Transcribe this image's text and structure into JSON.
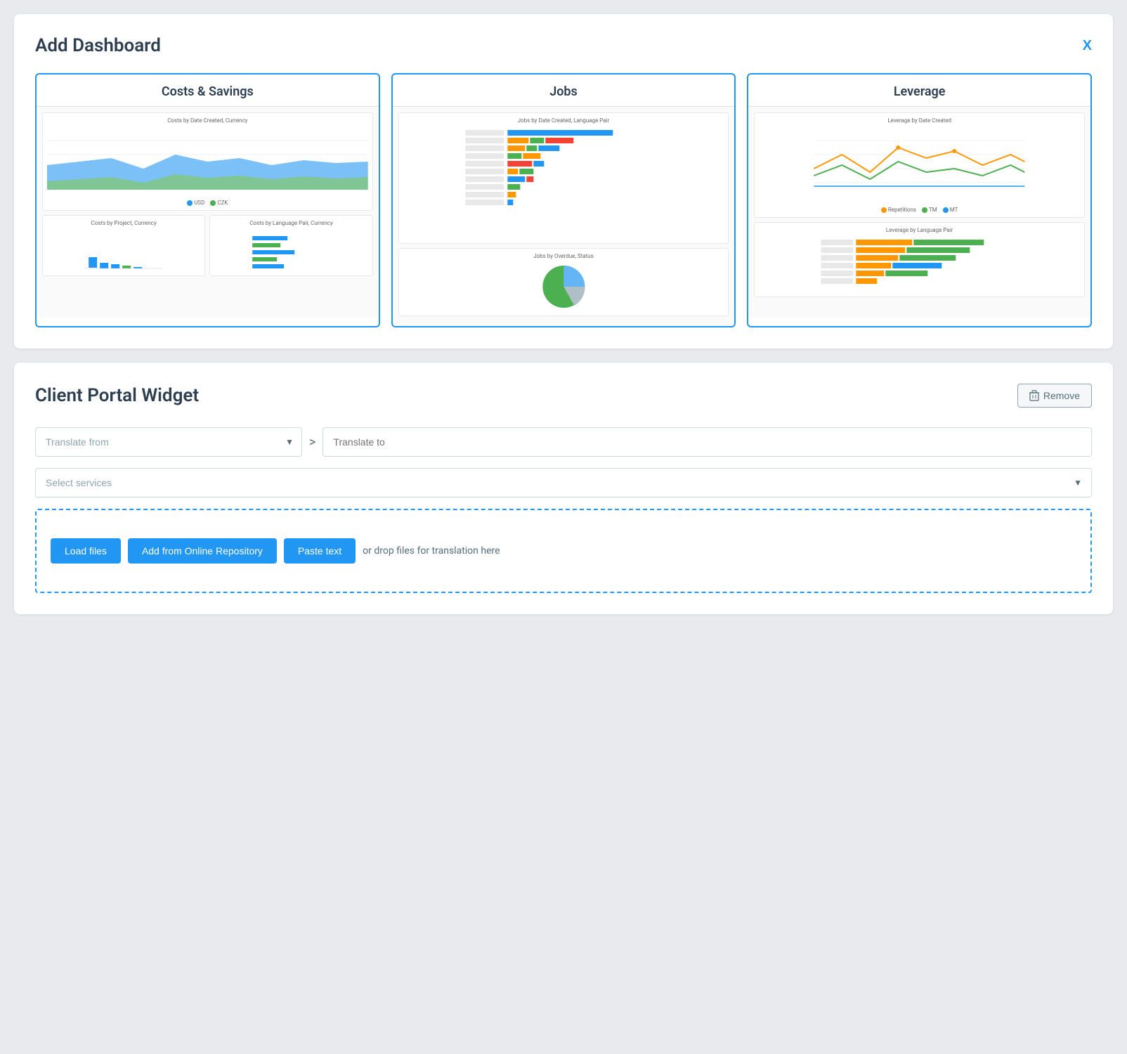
{
  "add_dashboard": {
    "title": "Add Dashboard",
    "close_label": "X",
    "cards": [
      {
        "id": "costs-savings",
        "title": "Costs & Savings",
        "main_chart_label": "Costs by Date Created, Currency",
        "legend": [
          {
            "label": "USD",
            "color": "#2196F3"
          },
          {
            "label": "CZK",
            "color": "#4CAF50"
          }
        ],
        "bottom_charts": [
          {
            "label": "Costs by Project, Currency"
          },
          {
            "label": "Costs by Language Pair, Currency"
          }
        ]
      },
      {
        "id": "jobs",
        "title": "Jobs",
        "main_chart_label": "Jobs by Date Created, Language Pair",
        "bottom_chart_label": "Jobs by Overdue, Status"
      },
      {
        "id": "leverage",
        "title": "Leverage",
        "main_chart_label": "Leverage by Date Created",
        "legend": [
          {
            "label": "Repetitions",
            "color": "#FF9800"
          },
          {
            "label": "TM",
            "color": "#4CAF50"
          },
          {
            "label": "MT",
            "color": "#2196F3"
          }
        ],
        "bottom_chart_label": "Leverage by Language Pair"
      }
    ]
  },
  "widget": {
    "title": "Client Portal Widget",
    "remove_label": "Remove",
    "translate_from_placeholder": "Translate from",
    "translate_to_placeholder": "Translate to",
    "arrow_symbol": ">",
    "services_placeholder": "Select services",
    "load_files_label": "Load files",
    "add_repo_label": "Add from Online Repository",
    "paste_text_label": "Paste text",
    "drop_text": "or drop files for translation here"
  }
}
